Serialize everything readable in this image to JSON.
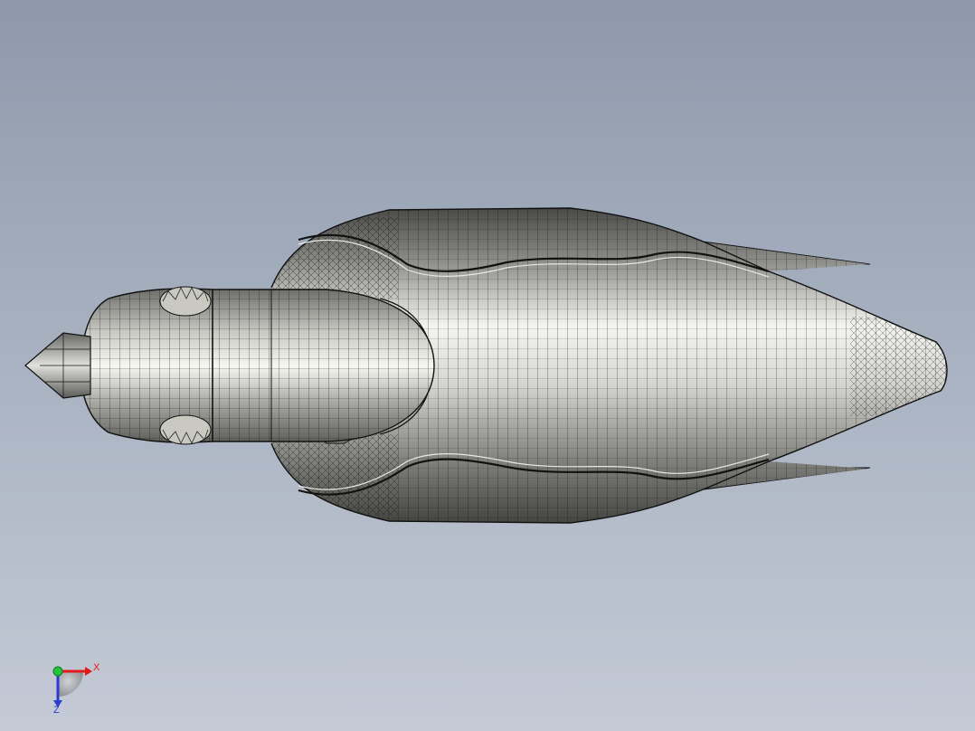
{
  "viewport": {
    "background_top": "#8d99ab",
    "background_bottom": "#c4cad6"
  },
  "model": {
    "description_icon": "rocket-wireframe-icon",
    "edge_color": "#111111",
    "shade_light": "#f2f2ee",
    "shade_dark": "#4a4a48"
  },
  "triad": {
    "x_label": "X",
    "z_label": "Z",
    "x_color": "#e21a1a",
    "y_color": "#22c43a",
    "z_color": "#2a3bd0"
  }
}
